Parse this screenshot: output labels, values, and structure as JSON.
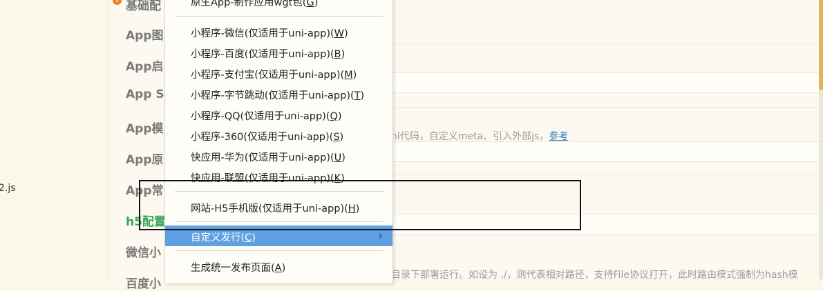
{
  "left": {
    "file_label": "2.js"
  },
  "sections": {
    "basic": "基础配",
    "icon": "App图",
    "splash": "App启",
    "sdk": "App SI",
    "module": "App模",
    "native": "App原",
    "common": "App常",
    "h5": "h5配置",
    "wechat": "微信小",
    "baidu": "百度小"
  },
  "hints": {
    "template_prefix": "nl代码，自定义meta、引入外部js，",
    "template_link": "参考",
    "h5_path": "目录下部署运行。如设为 ./，则代表相对路径，支持File协议打开，此时路由模式强制为hash模"
  },
  "menu": {
    "items": [
      {
        "label": "原生App-制作应用wgt包(",
        "key": "G"
      },
      {
        "label": "小程序-微信(仅适用于uni-app)(",
        "key": "W"
      },
      {
        "label": "小程序-百度(仅适用于uni-app)(",
        "key": "B"
      },
      {
        "label": "小程序-支付宝(仅适用于uni-app)(",
        "key": "M"
      },
      {
        "label": "小程序-字节跳动(仅适用于uni-app)(",
        "key": "T"
      },
      {
        "label": "小程序-QQ(仅适用于uni-app)(",
        "key": "Q"
      },
      {
        "label": "小程序-360(仅适用于uni-app)(",
        "key": "S"
      },
      {
        "label": "快应用-华为(仅适用于uni-app)(",
        "key": "U"
      },
      {
        "label": "快应用-联盟(仅适用于uni-app)(",
        "key": "K"
      },
      {
        "label": "网站-H5手机版(仅适用于uni-app)(",
        "key": "H"
      },
      {
        "label": "自定义发行(",
        "key": "C"
      },
      {
        "label": "生成统一发布页面(",
        "key": "A"
      }
    ],
    "close_paren": ")",
    "submenu_arrow": "›",
    "selected_index": 10
  },
  "colors": {
    "selected_bg": "#5fa0e3",
    "link": "#2c7cc7",
    "green_label": "#3aa55a",
    "warning": "#e8831f"
  }
}
